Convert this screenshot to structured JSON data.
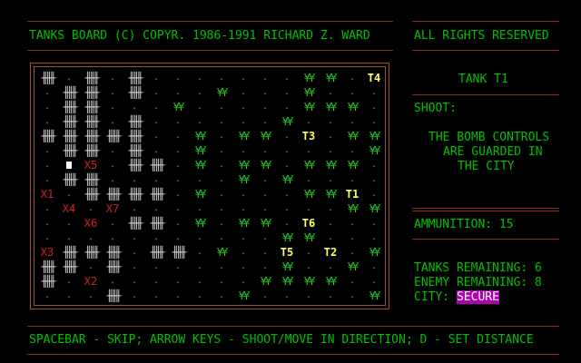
{
  "header": {
    "title": "TANKS BOARD (C) COPYR. 1986-1991 RICHARD Z. WARD",
    "rights": "ALL RIGHTS RESERVED"
  },
  "side": {
    "tank_label": "TANK T1",
    "shoot_label": "SHOOT:",
    "message_lines": [
      "THE BOMB CONTROLS",
      "ARE GUARDED IN",
      "THE CITY"
    ],
    "ammunition": "AMMUNITION: 15",
    "tanks_remaining": "TANKS REMAINING: 6",
    "enemy_remaining": "ENEMY REMAINING: 8",
    "city_label": "CITY:",
    "city_status": "SECURE"
  },
  "footer": {
    "help": "SPACEBAR - SKIP; ARROW KEYS - SHOOT/MOVE IN DIRECTION; D - SET DISTANCE"
  },
  "board": {
    "rows": [
      "B.B.B.......YY.T",
      ".BB.B...Y...Y...",
      ".BB...Y.....YYY.",
      ".BB.B......Y....",
      "BBBBB..Y.YY.T.YY",
      ".BB.B..Y.......Y",
      ".PX.BB.Y.YY.YYY.",
      ".BB......Y.Y....",
      "X.BBBB.Y....YYT.",
      ".X.X..........YY",
      "..X.BB.Y.YY.T...",
      "...........YY...",
      "XBBB.BB.Y..T.T.Y",
      "BB.B.......Y..Y.",
      "B.X.......YYYY..",
      "...B.....Y.....Y"
    ],
    "labels": {
      "T4": [
        0,
        15
      ],
      "T3": [
        4,
        12
      ],
      "T1": [
        8,
        14
      ],
      "T6": [
        10,
        12
      ],
      "T5": [
        12,
        11
      ],
      "T2": [
        12,
        13
      ],
      "X5": [
        6,
        2
      ],
      "X1": [
        8,
        0
      ],
      "X4": [
        9,
        1
      ],
      "X7": [
        9,
        3
      ],
      "X6": [
        10,
        2
      ],
      "X3": [
        12,
        0
      ],
      "X2": [
        14,
        2
      ]
    },
    "tree_glyph": "¥¥",
    "building_glyph": "╫╫╫",
    "dot_glyph": "."
  }
}
